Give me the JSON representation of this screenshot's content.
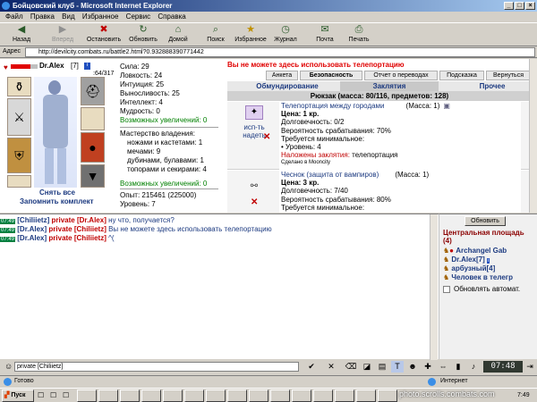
{
  "window": {
    "title": "Бойцовский клуб - Microsoft Internet Explorer"
  },
  "menu": [
    "Файл",
    "Правка",
    "Вид",
    "Избранное",
    "Сервис",
    "Справка"
  ],
  "toolbar": {
    "back": "Назад",
    "forward": "Вперед",
    "stop": "Остановить",
    "refresh": "Обновить",
    "home": "Домой",
    "search": "Поиск",
    "favorites": "Избранное",
    "history": "Журнал",
    "mail": "Почта",
    "print": "Печать"
  },
  "address": {
    "label": "Адрес",
    "url": "http://devilcity.combats.ru/battle2.html?0.932888390771442"
  },
  "character": {
    "name": "Dr.Alex",
    "level": "[7]",
    "hp": ":64/317",
    "undress_all": "Снять все",
    "remember_set": "Запомнить комплект"
  },
  "stats": {
    "strength": "Сила: 29",
    "agility": "Ловкость: 24",
    "intuition": "Интуиция: 25",
    "endurance": "Выносливость: 25",
    "intellect": "Интеллект: 4",
    "wisdom": "Мудрость: 0",
    "possible_increases": "Возможных увеличений: 0"
  },
  "mastery": {
    "title": "Мастерство владения:",
    "knives": "ножами и кастетами: 1",
    "swords": "мечами: 9",
    "clubs": "дубинами, булавами: 1",
    "axes": "топорами и секирами: 4",
    "possible_increases": "Возможных увеличений: 0"
  },
  "experience": {
    "exp": "Опыт: 215461 (225000)",
    "level": "Уровень: 7"
  },
  "warning": "Вы не можете здесь использовать телепортацию",
  "tabs": [
    "Анкета",
    "Безопасность",
    "Отчет о переводах",
    "Подсказка",
    "Вернуться"
  ],
  "subtabs": [
    "Обмундирование",
    "Заклятия",
    "Прочее"
  ],
  "backpack": "Рюкзак (масса: 80/116, предметов: 128)",
  "scrolls": [
    {
      "name": "Телепортация между городами",
      "mass": "(Масса: 1)",
      "price": "Цена: 1 кр.",
      "durability": "Долговечность: 0/2",
      "chance": "Вероятность срабатывания: 70%",
      "required": "Требуется минимальное:",
      "req_level": "• Уровень: 4",
      "spell_label": "Наложены заклятия:",
      "spell_value": "телепортация",
      "made": "Сделано в Mooncity",
      "action": "исп-ть надеть"
    },
    {
      "name": "Чеснок (защита от вампиров)",
      "mass": "(Масса: 1)",
      "price": "Цена: 3 кр.",
      "durability": "Долговечность: 7/40",
      "chance": "Вероятность срабатывания: 80%",
      "required": "Требуется минимальное:"
    }
  ],
  "chat": [
    {
      "time": "07:49",
      "from": "[Chiliietz]",
      "kind": "private",
      "to": "[Dr.Alex]",
      "text": "ну что, получается?"
    },
    {
      "time": "07:49",
      "from": "[Dr.Alex]",
      "kind": "private",
      "to": "[Chiliietz]",
      "text": "Вы не можете здесь использовать телепортацию"
    },
    {
      "time": "07:49",
      "from": "[Dr.Alex]",
      "kind": "private",
      "to": "[Chiliietz]",
      "text": "^("
    }
  ],
  "online": {
    "refresh": "Обновить",
    "location": "Центральная площадь (4)",
    "users": [
      "Archangel Gab",
      "Dr.Alex[7]",
      "арбузный[4]",
      "Человек в телегр"
    ],
    "auto_refresh": "Обновлять автомат."
  },
  "input": {
    "value": "private [Chiliietz]"
  },
  "clock": "07:48",
  "status": {
    "ready": "Готово",
    "zone": "Интернет"
  },
  "taskbar": {
    "start": "Пуск",
    "watermark": "photo.scrolls.combats.com",
    "time": "7:49"
  }
}
